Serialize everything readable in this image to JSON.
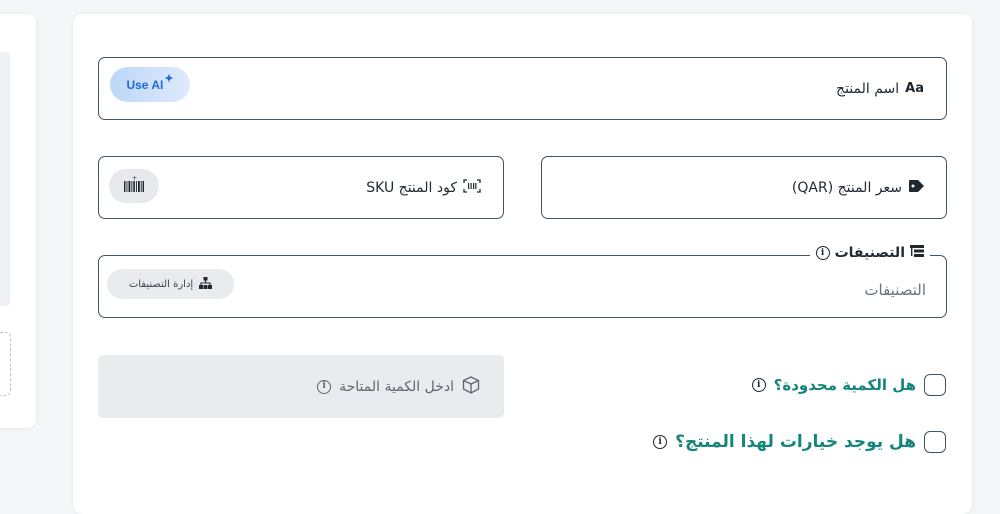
{
  "product_name": {
    "label": "اسم المنتج",
    "prefix_icon": "text-aa-icon",
    "prefix_text": "Aa",
    "ai_button_label": "Use AI",
    "ai_button_icon": "sparkle-icon"
  },
  "price": {
    "label": "سعر المنتج (QAR)",
    "icon": "price-tag-icon"
  },
  "sku": {
    "label": "كود المنتج SKU",
    "icon": "barcode-scan-icon",
    "generate_button_icon": "barcode-generate-icon"
  },
  "categories": {
    "legend": "التصنيفات",
    "legend_icon": "category-tree-icon",
    "placeholder": "التصنيفات",
    "manage_button_label": "إدارة التصنيفات",
    "manage_button_icon": "hierarchy-icon"
  },
  "quantity": {
    "placeholder": "ادخل الكمية المتاحة",
    "icon": "box-icon"
  },
  "limited_quantity": {
    "label": "هل الكمية محدودة؟",
    "checked": false
  },
  "has_options": {
    "label": "هل يوجد خيارات لهذا المنتج؟",
    "checked": false
  },
  "colors": {
    "accent_green": "#13857a",
    "field_border": "#3f5566",
    "ai_blue": "#1f6ad9"
  }
}
